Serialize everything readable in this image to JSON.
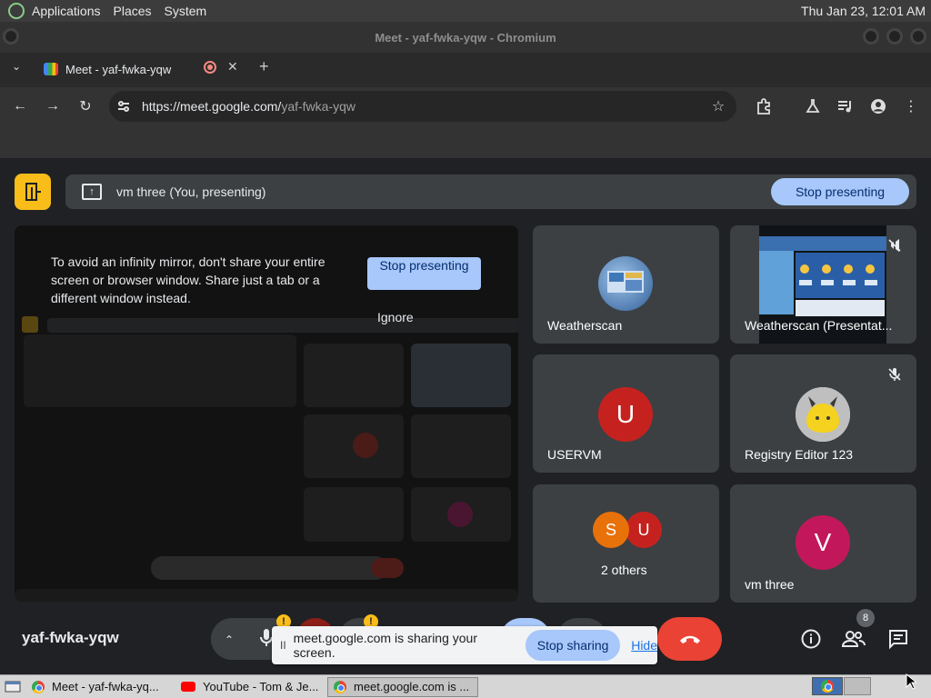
{
  "system_panel": {
    "menus": [
      "Applications",
      "Places",
      "System"
    ],
    "clock": "Thu Jan 23, 12:01 AM"
  },
  "window": {
    "title": "Meet - yaf-fwka-yqw - Chromium"
  },
  "browser": {
    "tab_label": "Meet - yaf-fwka-yqw",
    "url_host": "https://meet.google.com/",
    "url_path": "yaf-fwka-yqw"
  },
  "meet": {
    "presenting_text": "vm three (You, presenting)",
    "stop_presenting_label": "Stop presenting",
    "warning_text": "To avoid an infinity mirror, don't share your entire screen or browser window. Share just a tab or a different window instead.",
    "stop_presenting_inline_label": "Stop presenting",
    "ignore_label": "Ignore",
    "meeting_code": "yaf-fwka-yqw",
    "people_count": "8",
    "participants": [
      {
        "name": "Weatherscan"
      },
      {
        "name": "Weatherscan (Presentat..."
      },
      {
        "name": "USERVM",
        "initial": "U"
      },
      {
        "name": "Registry Editor 123"
      },
      {
        "name": "2 others",
        "initials": [
          "S",
          "U"
        ]
      },
      {
        "name": "vm three",
        "initial": "V"
      }
    ],
    "share_notice": {
      "pause_glyph": "II",
      "text": "meet.google.com is sharing your screen.",
      "stop_sharing_label": "Stop sharing",
      "hide_label": "Hide"
    },
    "colors": {
      "accent": "#a8c7fa",
      "end_call": "#ea4335",
      "door_button": "#f9bd1a",
      "avatar_u": "#c5221f",
      "avatar_s": "#e8710a",
      "avatar_v": "#c2185b"
    }
  },
  "taskbar": {
    "items": [
      {
        "label": "Meet - yaf-fwka-yq...",
        "icon": "chrome-icon"
      },
      {
        "label": "YouTube - Tom & Je...",
        "icon": "youtube-icon"
      },
      {
        "label": "meet.google.com is ...",
        "icon": "chrome-icon"
      }
    ]
  }
}
